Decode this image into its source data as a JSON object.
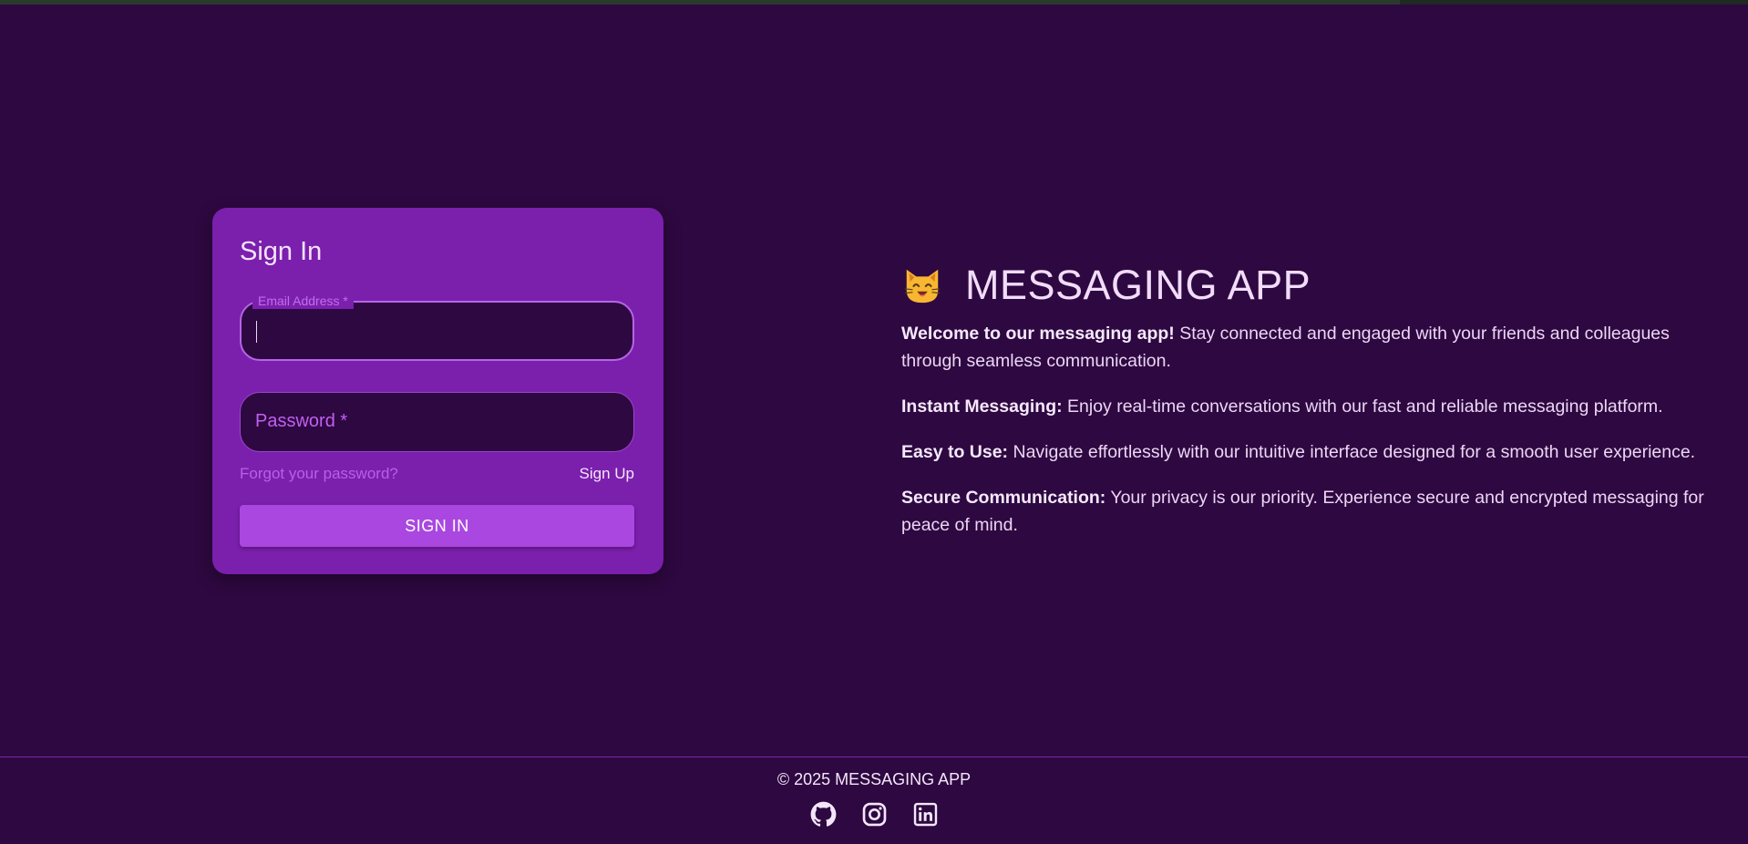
{
  "colors": {
    "background": "#2e0840",
    "card": "#7b1fad",
    "button": "#a947e0",
    "accent_label": "#c060f2"
  },
  "signin": {
    "title": "Sign In",
    "email_label": "Email Address *",
    "email_value": "",
    "password_label": "Password *",
    "password_value": "",
    "forgot_link": "Forgot your password?",
    "signup_link": "Sign Up",
    "submit_label": "SIGN IN"
  },
  "info": {
    "icon": "cat-face-icon",
    "app_title": "MESSAGING APP",
    "paragraphs": [
      {
        "heading": "Welcome to our messaging app!",
        "text": " Stay connected and engaged with your friends and colleagues through seamless communication."
      },
      {
        "heading": "Instant Messaging:",
        "text": " Enjoy real-time conversations with our fast and reliable messaging platform."
      },
      {
        "heading": "Easy to Use:",
        "text": " Navigate effortlessly with our intuitive interface designed for a smooth user experience."
      },
      {
        "heading": "Secure Communication:",
        "text": " Your privacy is our priority. Experience secure and encrypted messaging for peace of mind."
      }
    ]
  },
  "footer": {
    "copyright": "© 2025 MESSAGING APP",
    "socials": [
      "github-icon",
      "instagram-icon",
      "linkedin-icon"
    ]
  }
}
